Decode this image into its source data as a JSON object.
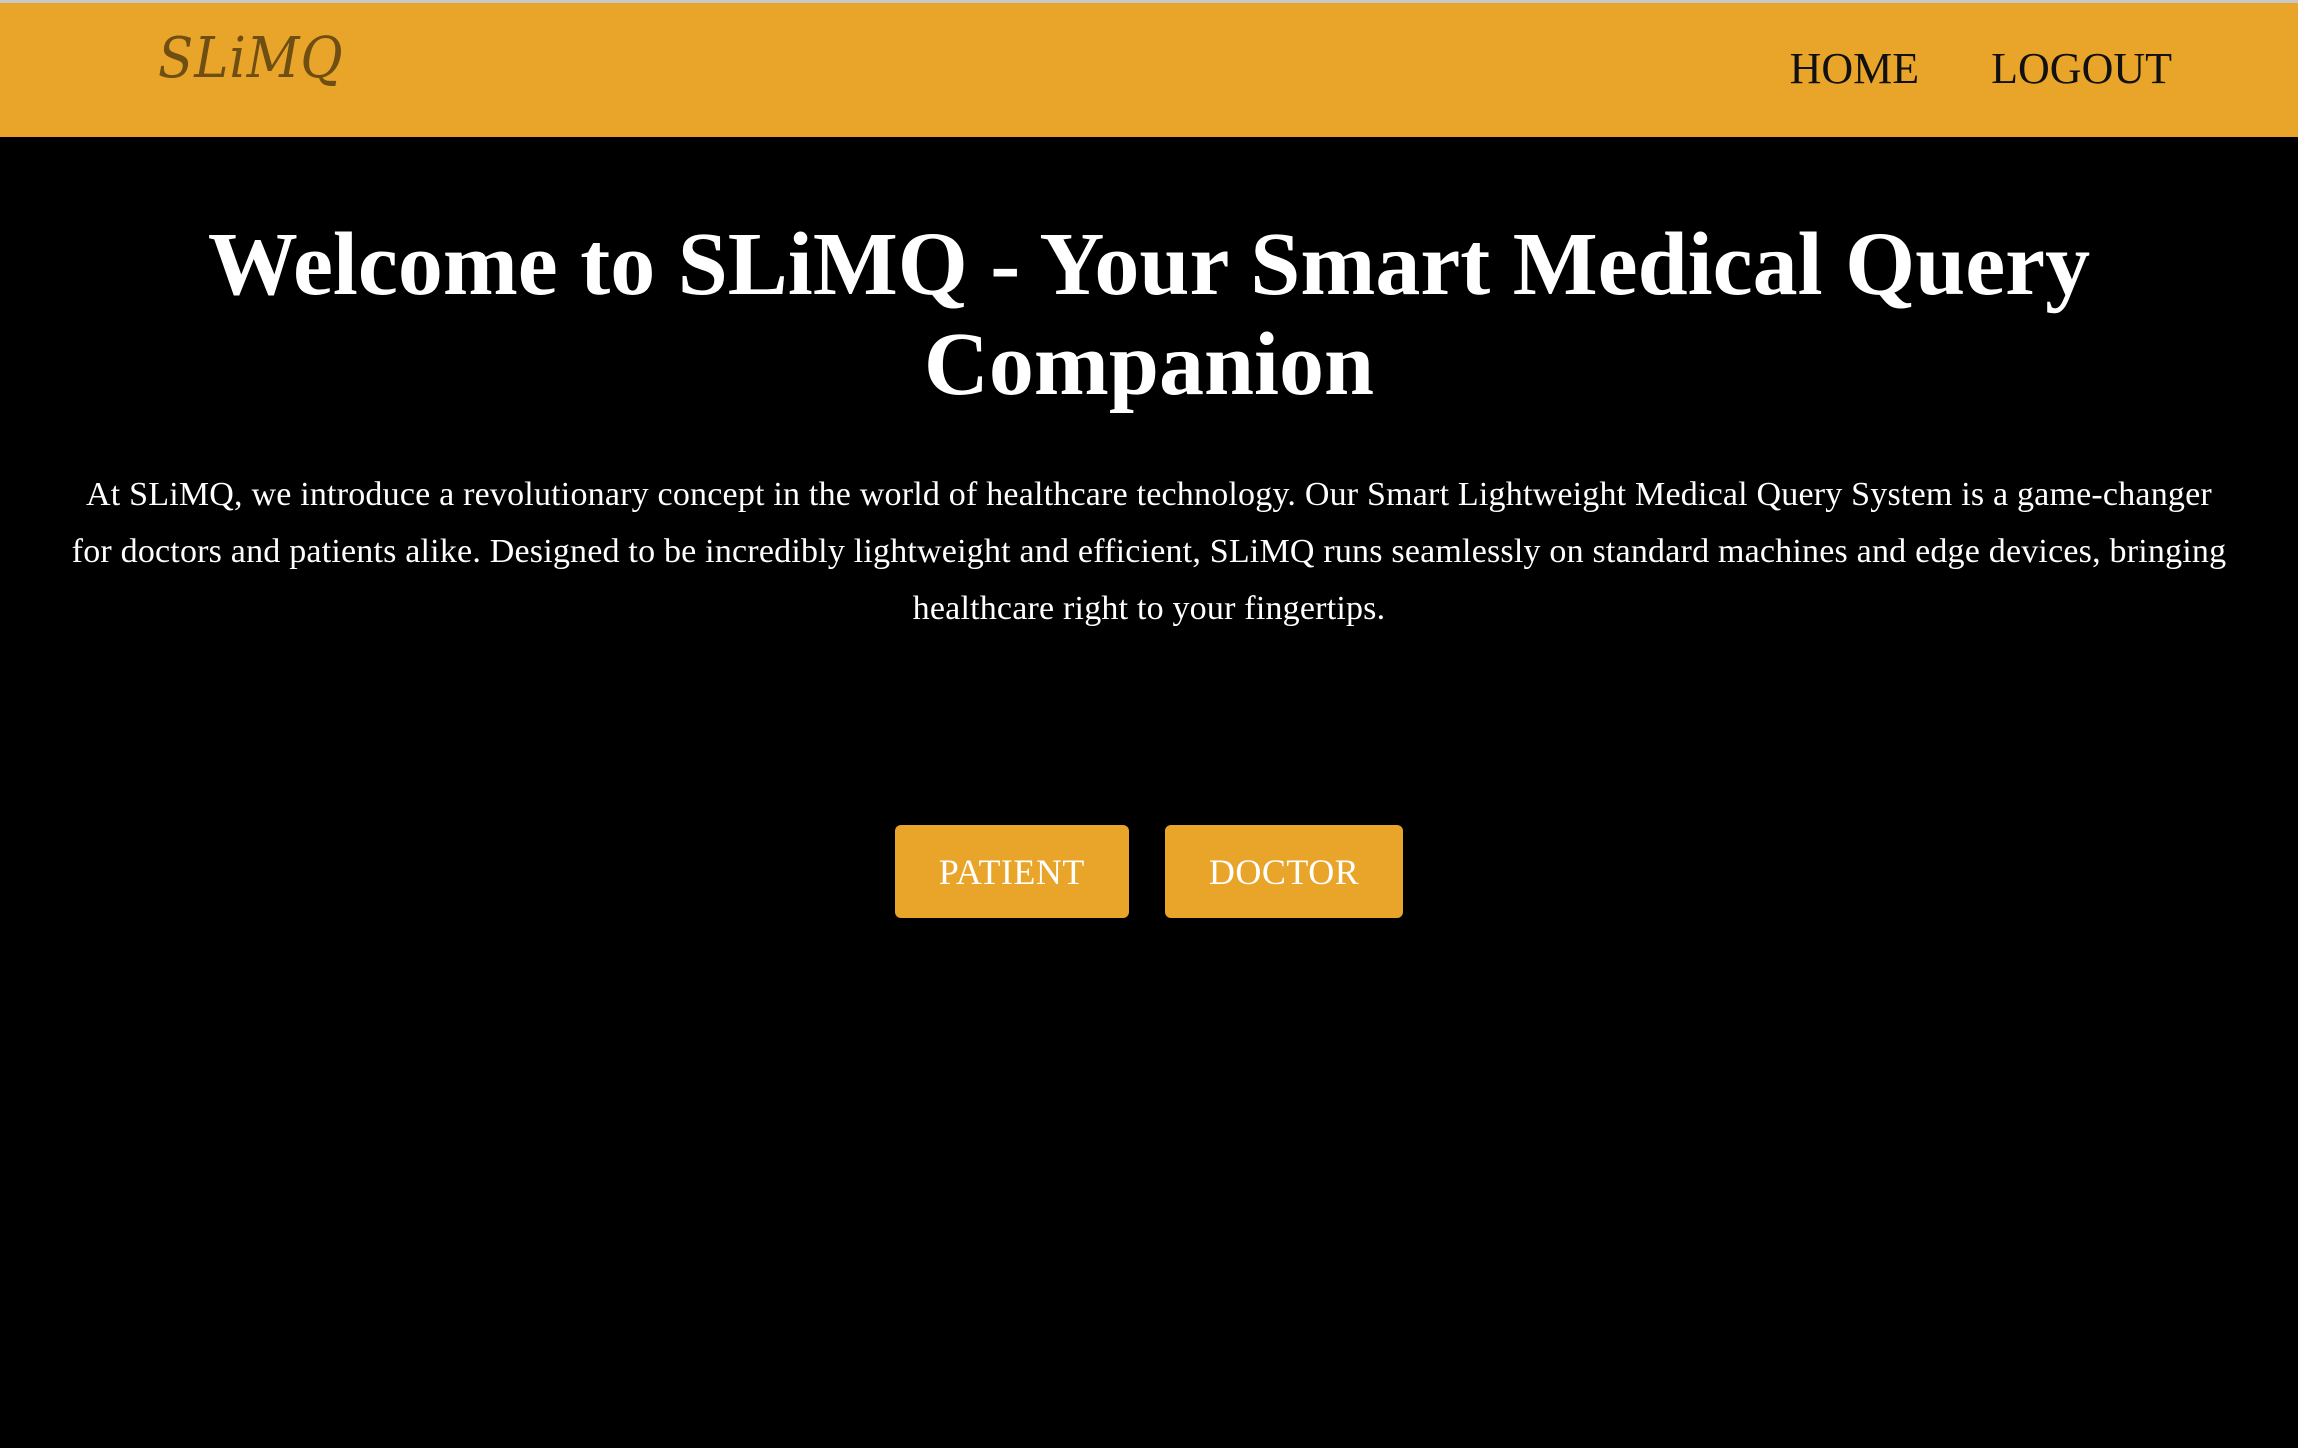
{
  "header": {
    "logo_text": "SLiMQ",
    "nav": {
      "home_label": "HOME",
      "logout_label": "LOGOUT"
    }
  },
  "hero": {
    "title": "Welcome to SLiMQ - Your Smart Medical Query Companion",
    "description": "At SLiMQ, we introduce a revolutionary concept in the world of healthcare technology. Our Smart Lightweight Medical Query System is a game-changer for doctors and patients alike. Designed to be incredibly lightweight and efficient, SLiMQ runs seamlessly on standard machines and edge devices, bringing healthcare right to your fingertips."
  },
  "actions": {
    "patient_label": "PATIENT",
    "doctor_label": "DOCTOR"
  },
  "colors": {
    "accent": "#e9a42a",
    "background": "#000000",
    "logo": "#6e4e12",
    "text": "#ffffff"
  }
}
